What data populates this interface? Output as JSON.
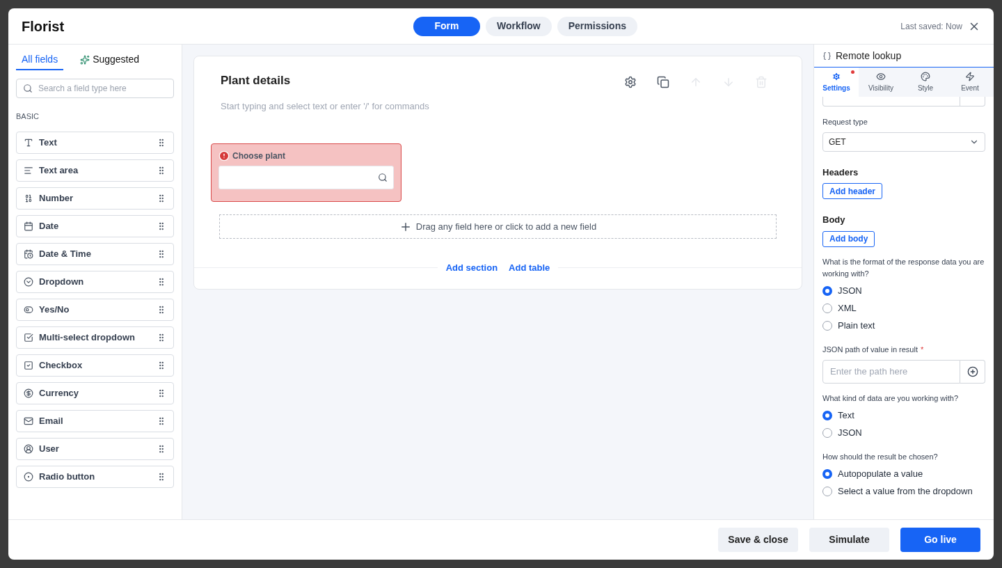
{
  "window": {
    "title": "Florist",
    "last_saved": "Last saved: Now"
  },
  "top_tabs": [
    {
      "label": "Form",
      "selected": true
    },
    {
      "label": "Workflow",
      "selected": false
    },
    {
      "label": "Permissions",
      "selected": false
    }
  ],
  "sidebar": {
    "tabs": [
      {
        "label": "All fields",
        "kind": "plain",
        "selected": true
      },
      {
        "label": "Suggested",
        "kind": "ai",
        "selected": false
      }
    ],
    "search": {
      "placeholder": "Search a field type here"
    },
    "section": "BASIC",
    "items": [
      {
        "label": "Text",
        "kind": "text"
      },
      {
        "label": "Text area",
        "kind": "textarea"
      },
      {
        "label": "Number",
        "kind": "number"
      },
      {
        "label": "Date",
        "kind": "date"
      },
      {
        "label": "Date & Time",
        "kind": "datetime"
      },
      {
        "label": "Dropdown",
        "kind": "dropdown"
      },
      {
        "label": "Yes/No",
        "kind": "toggle"
      },
      {
        "label": "Multi-select dropdown",
        "kind": "multiselect"
      },
      {
        "label": "Checkbox",
        "kind": "checkbox"
      },
      {
        "label": "Currency",
        "kind": "currency"
      },
      {
        "label": "Email",
        "kind": "email"
      },
      {
        "label": "User",
        "kind": "user"
      },
      {
        "label": "Radio button",
        "kind": "radio"
      }
    ]
  },
  "canvas": {
    "title": "Plant details",
    "description_placeholder": "Start typing and select text or enter '/' for commands",
    "toolbar": [
      {
        "kind": "settings",
        "disabled": false
      },
      {
        "kind": "copy",
        "disabled": false
      },
      {
        "kind": "up",
        "disabled": true
      },
      {
        "kind": "down",
        "disabled": true
      },
      {
        "kind": "delete",
        "disabled": true
      }
    ],
    "fields": [
      {
        "label": "Choose plant",
        "error": true
      }
    ],
    "drop_zone": "Drag any field here or click to add a new field",
    "links": [
      "Add section",
      "Add table"
    ]
  },
  "panel": {
    "title": "Remote lookup",
    "tabs": [
      {
        "label": "Settings",
        "kind": "settings",
        "selected": true,
        "alert": true
      },
      {
        "label": "Visibility",
        "kind": "visibility",
        "selected": false,
        "alert": false
      },
      {
        "label": "Style",
        "kind": "style",
        "selected": false,
        "alert": false
      },
      {
        "label": "Event",
        "kind": "event",
        "selected": false,
        "alert": false
      }
    ],
    "request_type": {
      "label": "Request type",
      "value": "GET"
    },
    "headers": {
      "title": "Headers",
      "button": "Add header"
    },
    "body": {
      "title": "Body",
      "button": "Add body"
    },
    "groups": [
      {
        "kind": "radio",
        "question": "What is the format of the response data you are working with?",
        "options": [
          {
            "label": "JSON",
            "selected": true
          },
          {
            "label": "XML",
            "selected": false
          },
          {
            "label": "Plain text",
            "selected": false
          }
        ]
      },
      {
        "kind": "input",
        "question": "JSON path of value in result",
        "required_mark": "*",
        "placeholder": "Enter the path here"
      },
      {
        "kind": "radio",
        "question": "What kind of data are you working with?",
        "options": [
          {
            "label": "Text",
            "selected": true
          },
          {
            "label": "JSON",
            "selected": false
          }
        ]
      },
      {
        "kind": "radio",
        "question": "How should the result be chosen?",
        "options": [
          {
            "label": "Autopopulate a value",
            "selected": true
          },
          {
            "label": "Select a value from the dropdown",
            "selected": false
          }
        ]
      }
    ]
  },
  "footer": {
    "buttons": [
      {
        "label": "Save & close",
        "kind": "secondary"
      },
      {
        "label": "Simulate",
        "kind": "secondary"
      },
      {
        "label": "Go live",
        "kind": "primary"
      }
    ]
  }
}
